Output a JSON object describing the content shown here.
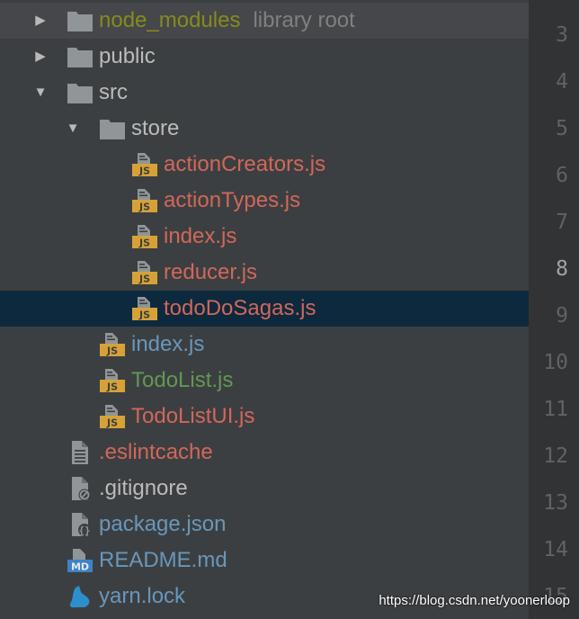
{
  "colors": {
    "folder_icon": "#8f9599",
    "js_icon": "#d6a237",
    "js_icon_text": "#3c3f41",
    "default_text": "#bbbbbb",
    "excluded_text": "#888a1c",
    "modified_text": "#6897bb",
    "added_text": "#629755",
    "unversioned_text": "#d1675a",
    "hint_text": "#808080",
    "md_icon": "#3d82c8",
    "yarn_icon": "#2d8ece",
    "selected_row": "#0d293e",
    "line_number": "#606366",
    "current_line_number": "#a4a3a3"
  },
  "tree": {
    "items": [
      {
        "label": "node_modules",
        "hint": "library root",
        "icon": "folder-icon",
        "arrow": "chevron-right-icon",
        "indent": 0,
        "color": "#888a1c",
        "highlight": true
      },
      {
        "label": "public",
        "icon": "folder-icon",
        "arrow": "chevron-right-icon",
        "indent": 0,
        "color": "#bbbbbb"
      },
      {
        "label": "src",
        "icon": "folder-icon",
        "arrow": "chevron-down-icon",
        "indent": 0,
        "color": "#bbbbbb"
      },
      {
        "label": "store",
        "icon": "folder-icon",
        "arrow": "chevron-down-icon",
        "indent": 1,
        "color": "#bbbbbb"
      },
      {
        "label": "actionCreators.js",
        "icon": "js-file-icon",
        "indent": 2,
        "color": "#d1675a"
      },
      {
        "label": "actionTypes.js",
        "icon": "js-file-icon",
        "indent": 2,
        "color": "#d1675a"
      },
      {
        "label": "index.js",
        "icon": "js-file-icon",
        "indent": 2,
        "color": "#d1675a"
      },
      {
        "label": "reducer.js",
        "icon": "js-file-icon",
        "indent": 2,
        "color": "#d1675a"
      },
      {
        "label": "todoDoSagas.js",
        "icon": "js-file-icon",
        "indent": 2,
        "color": "#d1675a",
        "selected": true
      },
      {
        "label": "index.js",
        "icon": "js-file-icon",
        "indent": 1,
        "color": "#6897bb"
      },
      {
        "label": "TodoList.js",
        "icon": "js-file-icon",
        "indent": 1,
        "color": "#629755"
      },
      {
        "label": "TodoListUI.js",
        "icon": "js-file-icon",
        "indent": 1,
        "color": "#d1675a"
      },
      {
        "label": ".eslintcache",
        "icon": "text-file-icon",
        "indent": 0,
        "color": "#d1675a"
      },
      {
        "label": ".gitignore",
        "icon": "ignore-file-icon",
        "indent": 0,
        "color": "#bbbbbb"
      },
      {
        "label": "package.json",
        "icon": "json-file-icon",
        "indent": 0,
        "color": "#6897bb"
      },
      {
        "label": "README.md",
        "icon": "markdown-file-icon",
        "indent": 0,
        "color": "#6897bb"
      },
      {
        "label": "yarn.lock",
        "icon": "yarn-file-icon",
        "indent": 0,
        "color": "#6897bb"
      }
    ]
  },
  "gutter": {
    "line_numbers": [
      "3",
      "4",
      "5",
      "6",
      "7",
      "8",
      "9",
      "10",
      "11",
      "12",
      "13",
      "14",
      "15"
    ],
    "current_line": "8"
  },
  "watermark": "https://blog.csdn.net/yoonerloop"
}
